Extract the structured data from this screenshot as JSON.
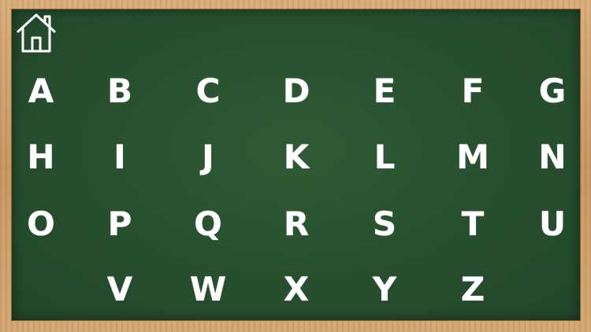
{
  "home_icon": "house-icon",
  "colors": {
    "board": "#274f2e",
    "frame": "#c89562",
    "chalk": "#ffffff"
  },
  "rows": [
    [
      "A",
      "B",
      "C",
      "D",
      "E",
      "F",
      "G"
    ],
    [
      "H",
      "I",
      "J",
      "K",
      "L",
      "M",
      "N"
    ],
    [
      "O",
      "P",
      "Q",
      "R",
      "S",
      "T",
      "U"
    ],
    [
      "V",
      "W",
      "X",
      "Y",
      "Z"
    ]
  ]
}
